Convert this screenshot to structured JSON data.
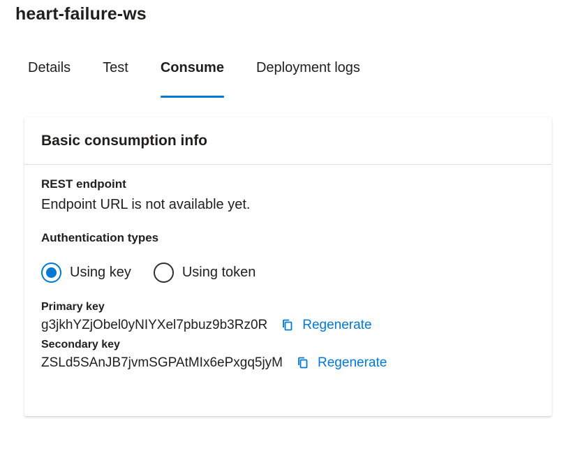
{
  "page": {
    "title": "heart-failure-ws"
  },
  "tabs": [
    {
      "label": "Details",
      "active": false
    },
    {
      "label": "Test",
      "active": false
    },
    {
      "label": "Consume",
      "active": true
    },
    {
      "label": "Deployment logs",
      "active": false
    }
  ],
  "card": {
    "title": "Basic consumption info",
    "rest": {
      "label": "REST endpoint",
      "value": "Endpoint URL is not available yet."
    },
    "auth": {
      "label": "Authentication types",
      "options": [
        {
          "label": "Using key",
          "selected": true
        },
        {
          "label": "Using token",
          "selected": false
        }
      ]
    },
    "keys": {
      "primary": {
        "label": "Primary key",
        "value": "g3jkhYZjObel0yNIYXel7pbuz9b3Rz0R",
        "action": "Regenerate",
        "icon": "copy-icon"
      },
      "secondary": {
        "label": "Secondary key",
        "value": "ZSLd5SAnJB7jvmSGPAtMIx6ePxgq5jyM",
        "action": "Regenerate",
        "icon": "copy-icon"
      }
    }
  },
  "colors": {
    "accent": "#0078d4",
    "text": "#201f1e",
    "divider": "#e1dfdd"
  }
}
